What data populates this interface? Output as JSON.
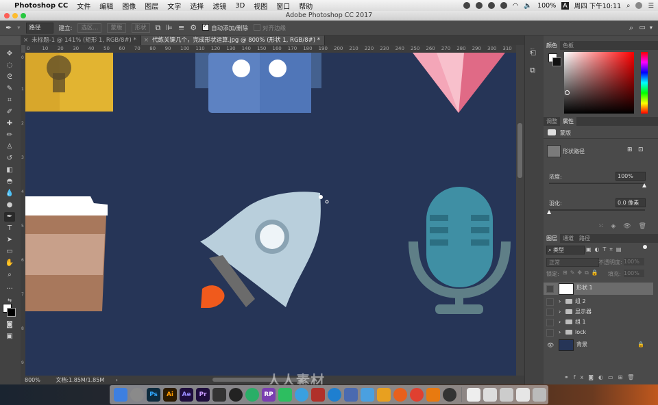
{
  "menubar": {
    "app_name": "Photoshop CC",
    "items": [
      "文件",
      "编辑",
      "图像",
      "图层",
      "文字",
      "选择",
      "滤镜",
      "3D",
      "视图",
      "窗口",
      "帮助"
    ],
    "battery": "100%",
    "clock": "周四 下午10:11",
    "input_source": "A"
  },
  "window": {
    "title": "Adobe Photoshop CC 2017"
  },
  "options": {
    "mode": "路径",
    "make_label": "建立:",
    "selection_btn": "选区...",
    "mask_btn": "蒙版",
    "shape_btn": "形状",
    "auto_add_delete": "自动添加/删除",
    "align_edges": "对齐边缘"
  },
  "tabs": [
    {
      "label": "未标题-1 @ 141% (矩形 1, RGB/8#) *"
    },
    {
      "label": "代练关键几个，完成形状运算.jpg @ 800% (形状 1, RGB/8#) *"
    }
  ],
  "ruler": {
    "h_ticks": [
      "0",
      "10",
      "20",
      "30",
      "40",
      "50",
      "60",
      "70",
      "80",
      "90",
      "100",
      "110",
      "120",
      "130",
      "140",
      "150",
      "160",
      "170",
      "180",
      "190",
      "200",
      "210",
      "220",
      "230",
      "240",
      "250",
      "260",
      "270",
      "280",
      "290",
      "300",
      "310"
    ]
  },
  "status": {
    "zoom": "800%",
    "doc": "文档:1.85M/1.85M"
  },
  "color_panel": {
    "tabs": [
      "颜色",
      "色板"
    ]
  },
  "props_panel": {
    "tabs": [
      "调整",
      "属性"
    ],
    "mask_label": "蒙版",
    "shape_path_label": "形状路径",
    "density_label": "浓度:",
    "density_value": "100%",
    "feather_label": "羽化:",
    "feather_value": "0.0 像素",
    "density_level": 1.0,
    "feather_level": 0.0
  },
  "layers_panel": {
    "tabs": [
      "图层",
      "通道",
      "路径"
    ],
    "filter": "类型",
    "blend": "正常",
    "opacity": "不透明度:",
    "opacity_value": "100%",
    "lock": "锁定:",
    "fill": "填充:",
    "fill_value": "100%",
    "layers": [
      {
        "name": "形状 1",
        "type": "shape",
        "visible": false,
        "selected": true
      },
      {
        "name": "组 2",
        "type": "group",
        "visible": false
      },
      {
        "name": "显示器",
        "type": "group",
        "visible": false
      },
      {
        "name": "组 1",
        "type": "group",
        "visible": false
      },
      {
        "name": "lock",
        "type": "group",
        "visible": false
      },
      {
        "name": "背景",
        "type": "background",
        "visible": true
      }
    ]
  },
  "watermark": "人人素材",
  "dock_apps": [
    "Finder",
    "Launchpad",
    "Photoshop",
    "Illustrator",
    "After Effects",
    "Premiere",
    "Media Encoder",
    "QQ",
    "WeChat",
    "RP",
    "Evernote",
    "Safari",
    "Firefox",
    "Chrome",
    "VLC",
    "OBS",
    "Trash"
  ],
  "colors": {
    "canvas_bg": "#263557",
    "accent_blue": "#2b8cd6",
    "rocket_body": "#b9cfdc",
    "flame": "#f05a1c",
    "mic": "#3f8fa4",
    "mic_stand": "#5f7f87",
    "lock_yellow": "#d8a72b",
    "robot_blue": "#5d82c2",
    "cup_brown": "#a8785c"
  }
}
